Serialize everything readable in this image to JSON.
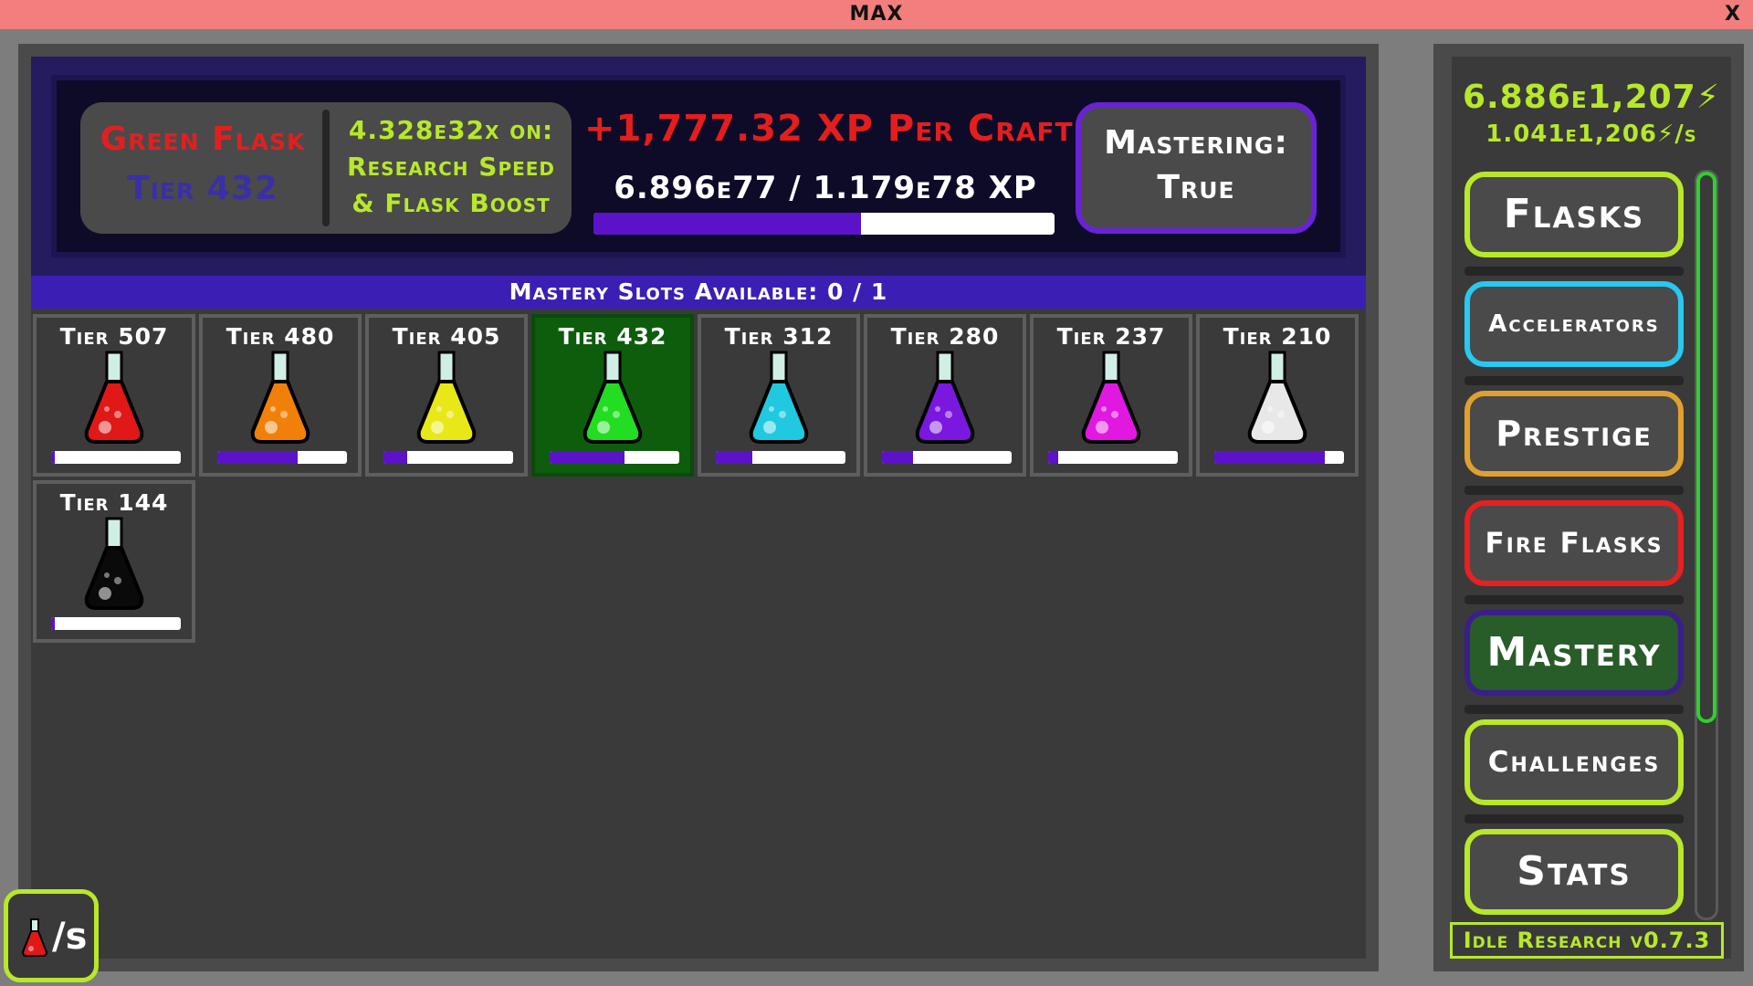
{
  "window": {
    "title": "MAX",
    "close_label": "X"
  },
  "header": {
    "flask_name": "Green Flask",
    "flask_tier": "Tier 432",
    "boost_lines": [
      "4.328e32x on:",
      "Research Speed",
      "& Flask Boost"
    ],
    "xp_per_craft": "+1,777.32 XP Per Craft",
    "xp_progress_text": "6.896e77 / 1.179e78 XP",
    "xp_progress_fraction": 0.58,
    "mastering_lines": [
      "Mastering:",
      "True"
    ]
  },
  "slots_label": "Mastery Slots Available: 0 / 1",
  "flasks": [
    {
      "tier": "Tier 507",
      "color": "#e01818",
      "progress": 0.03,
      "selected": false
    },
    {
      "tier": "Tier 480",
      "color": "#f0800a",
      "progress": 0.62,
      "selected": false
    },
    {
      "tier": "Tier 405",
      "color": "#e8e818",
      "progress": 0.18,
      "selected": false
    },
    {
      "tier": "Tier 432",
      "color": "#22dd22",
      "progress": 0.58,
      "selected": true
    },
    {
      "tier": "Tier 312",
      "color": "#20c8e0",
      "progress": 0.28,
      "selected": false
    },
    {
      "tier": "Tier 280",
      "color": "#7a18e0",
      "progress": 0.24,
      "selected": false
    },
    {
      "tier": "Tier 237",
      "color": "#e018e0",
      "progress": 0.08,
      "selected": false
    },
    {
      "tier": "Tier 210",
      "color": "#e8e8e8",
      "progress": 0.85,
      "selected": false
    },
    {
      "tier": "Tier 144",
      "color": "#0a0a0a",
      "progress": 0.03,
      "selected": false
    }
  ],
  "per_second_label": "/s",
  "sidebar": {
    "currency": "6.886e1,207",
    "rate": "1.041e1,206",
    "rate_unit": "/s",
    "buttons": [
      {
        "label": "Flasks",
        "border": "#b7e82a",
        "bg": "#4a4a4a"
      },
      {
        "label": "Accelerators",
        "border": "#28c8f0",
        "bg": "#4a4a4a"
      },
      {
        "label": "Prestige",
        "border": "#e0a030",
        "bg": "#4a4a4a"
      },
      {
        "label": "Fire Flasks",
        "border": "#e82020",
        "bg": "#4a4a4a"
      },
      {
        "label": "Mastery",
        "border": "#3a1f8a",
        "bg": "#285c28"
      },
      {
        "label": "Challenges",
        "border": "#b7e82a",
        "bg": "#4a4a4a"
      },
      {
        "label": "Stats",
        "border": "#b7e82a",
        "bg": "#4a4a4a"
      }
    ],
    "version": "Idle Research v0.7.3"
  }
}
